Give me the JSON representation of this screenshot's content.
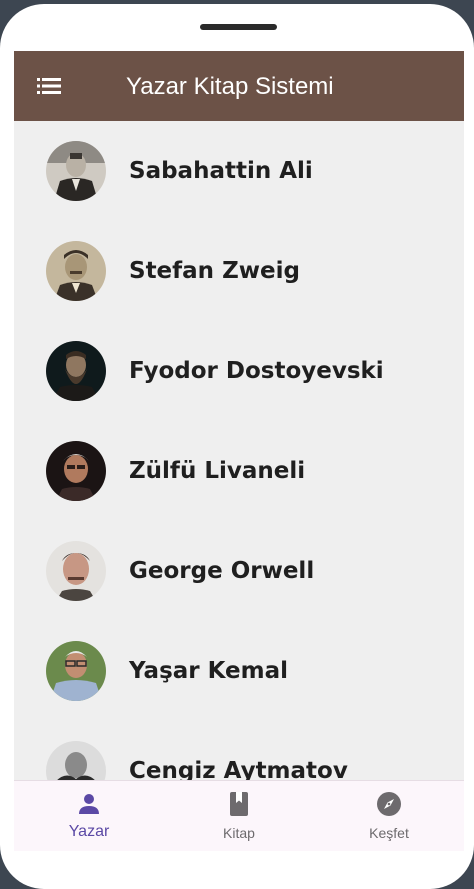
{
  "appbar": {
    "title": "Yazar Kitap Sistemi",
    "menu_icon": "menu-list-icon",
    "background": "#6c5247"
  },
  "authors": [
    {
      "name": "Sabahattin Ali",
      "avatar": "author-photo"
    },
    {
      "name": "Stefan Zweig",
      "avatar": "author-photo"
    },
    {
      "name": "Fyodor Dostoyevski",
      "avatar": "author-photo"
    },
    {
      "name": "Zülfü Livaneli",
      "avatar": "author-photo"
    },
    {
      "name": "George Orwell",
      "avatar": "author-photo"
    },
    {
      "name": "Yaşar Kemal",
      "avatar": "author-photo"
    },
    {
      "name": "Cengiz Aytmatov",
      "avatar": "author-photo"
    }
  ],
  "bottom_nav": {
    "items": [
      {
        "label": "Yazar",
        "icon": "person-icon",
        "active": true
      },
      {
        "label": "Kitap",
        "icon": "book-icon",
        "active": false
      },
      {
        "label": "Keşfet",
        "icon": "compass-icon",
        "active": false
      }
    ],
    "active_color": "#5b49a5",
    "inactive_color": "#6d6a6d"
  }
}
